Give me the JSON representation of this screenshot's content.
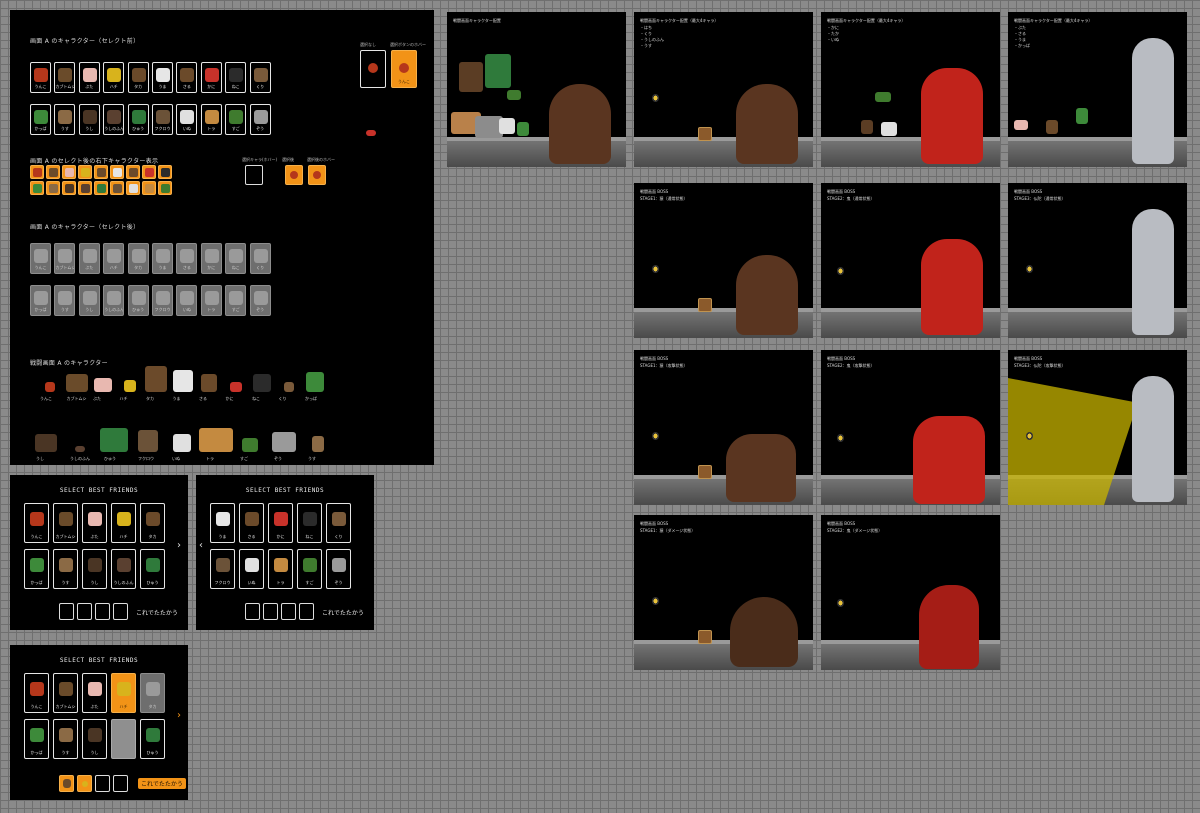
{
  "sheet": {
    "sec1_title": "画面 A のキャラクター（セレクト前）",
    "sec1_note_a": "選択なし",
    "sec1_note_b": "選択ボタンのホバー",
    "sec2_title": "画面 A のセレクト後の右下キャラクター表示",
    "sec2_note_a": "選択キャラ(ホバー)",
    "sec2_note_b": "選択後",
    "sec2_note_c": "選択後のホバー",
    "sec3_title": "画面 A のキャラクター（セレクト後）",
    "sec4_title": "戦闘画面 A のキャラクター",
    "row1_labels": [
      "うんこ",
      "カブトムシ",
      "ぶた",
      "ハチ",
      "タカ",
      "うま",
      "さる",
      "かに",
      "ねこ",
      "くり"
    ],
    "row2_labels": [
      "かっぱ",
      "うす",
      "うし",
      "うしのふん",
      "ひゅう",
      "フクロウ",
      "いぬ",
      "トラ",
      "すご",
      "ぞう"
    ],
    "side_card_a": "",
    "side_card_b": "うんこ",
    "sprites_row1": [
      "うんこ",
      "カブトムシ",
      "ぶた",
      "ハチ",
      "タカ",
      "うま",
      "さる",
      "かに",
      "ねこ",
      "くり",
      "かっぱ"
    ],
    "sprites_row2": [
      "うし",
      "うしのふん",
      "ひゅう",
      "フクロウ",
      "いぬ",
      "トラ",
      "すご",
      "ぞう",
      "うす"
    ]
  },
  "select_screens": [
    {
      "title": "SELECT BEST FRIENDS",
      "labels": [
        "うんこ",
        "カブトムシ",
        "ぶた",
        "ハチ",
        "タカ",
        "かっぱ",
        "うす",
        "うし",
        "うしのふん",
        "ひゅう"
      ],
      "fight": "これでたたかう"
    },
    {
      "title": "SELECT BEST FRIENDS",
      "labels": [
        "うま",
        "さる",
        "かに",
        "ねこ",
        "くり",
        "フクロウ",
        "いぬ",
        "トラ",
        "すご",
        "ぞう"
      ],
      "fight": "これでたたかう"
    },
    {
      "title": "SELECT BEST FRIENDS",
      "labels": [
        "うんこ",
        "カブトムシ",
        "ぶた",
        "ハチ",
        "タカ",
        "かっぱ",
        "うす",
        "うし",
        "",
        "ひゅう"
      ],
      "fight": "これでたたかう"
    }
  ],
  "scenes": {
    "title_main": "戦闘画面キャラクター配置",
    "title_g1": "戦闘画面キャラクター配置（最大4キャラ）",
    "title_g2": "戦闘画面キャラクター配置（最大4キャラ）",
    "title_g3": "戦闘画面キャラクター配置（最大4キャラ）",
    "list_g1": [
      "・はち",
      "・くり",
      "・うしのふん",
      "・うす"
    ],
    "list_g2": [
      "・かに",
      "・たか",
      "・いぬ"
    ],
    "list_g3": [
      "・ぶた",
      "・さる",
      "・うま",
      "・かっぱ"
    ],
    "boss": "戦闘画面 BOSS",
    "s1_idle": "STAGE1：猿（通常状態）",
    "s2_idle": "STAGE2：鬼（通常状態）",
    "s3_idle": "STAGE3：仏陀（通常状態）",
    "s1_attack": "STAGE1：猿（攻撃状態）",
    "s2_attack": "STAGE2：鬼（攻撃状態）",
    "s3_attack": "STAGE3：仏陀（攻撃状態）",
    "s1_damage": "STAGE1：猿（ダメージ状態）",
    "s2_damage": "STAGE2：鬼（ダメージ状態）"
  },
  "colors": {
    "accent": "#f29317",
    "boss_ape": "#5a3520",
    "boss_oni": "#c1231b",
    "boss_buddha": "#b9bcc2",
    "beam": "#c8b400"
  },
  "icons": [
    "poop-icon",
    "beetle-icon",
    "pig-icon",
    "bee-icon",
    "hawk-icon",
    "horse-icon",
    "monkey-icon",
    "crab-icon",
    "cat-icon",
    "chestnut-icon",
    "kappa-icon",
    "mortar-icon",
    "cow-icon",
    "cow-dung-icon",
    "snake-icon",
    "owl-icon",
    "dog-icon",
    "tiger-icon",
    "pheasant-icon",
    "elephant-icon",
    "arrow-right-icon",
    "arrow-left-icon"
  ]
}
